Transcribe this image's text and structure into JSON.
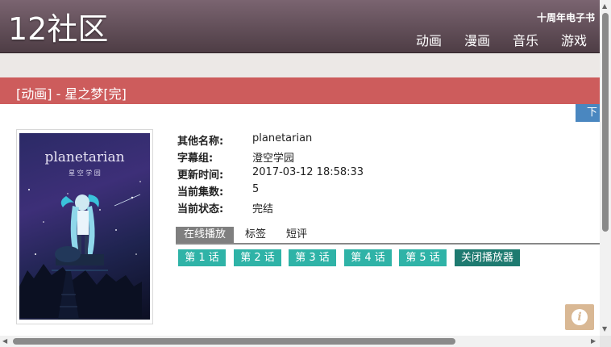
{
  "header": {
    "logo": "12社区",
    "anniversary": "十周年电子书",
    "nav": [
      "动画",
      "漫画",
      "音乐",
      "游戏"
    ]
  },
  "title_bar": {
    "title": "[动画] - 星之梦[完]"
  },
  "download_button": "下",
  "poster": {
    "title": "planetarian",
    "subtitle": "星 空 学 园"
  },
  "info": [
    {
      "key": "其他名称:",
      "value": "planetarian"
    },
    {
      "key": "字幕组:",
      "value": "澄空学园"
    },
    {
      "key": "更新时间:",
      "value": "2017-03-12 18:58:33"
    },
    {
      "key": "当前集数:",
      "value": "5"
    },
    {
      "key": "当前状态:",
      "value": "完结"
    }
  ],
  "tabs": [
    "在线播放",
    "标签",
    "短评"
  ],
  "episodes": [
    "第 1 话",
    "第 2 话",
    "第 3 话",
    "第 4 话",
    "第 5 话"
  ],
  "close_player": "关闭播放器",
  "info_button_icon": "info-icon",
  "colors": {
    "header": "#6b5560",
    "title_bar": "#cd5c5c",
    "episode": "#2fb3a7",
    "close_player": "#1e7a70",
    "download": "#4a87c0",
    "info_button": "#d9b894"
  }
}
